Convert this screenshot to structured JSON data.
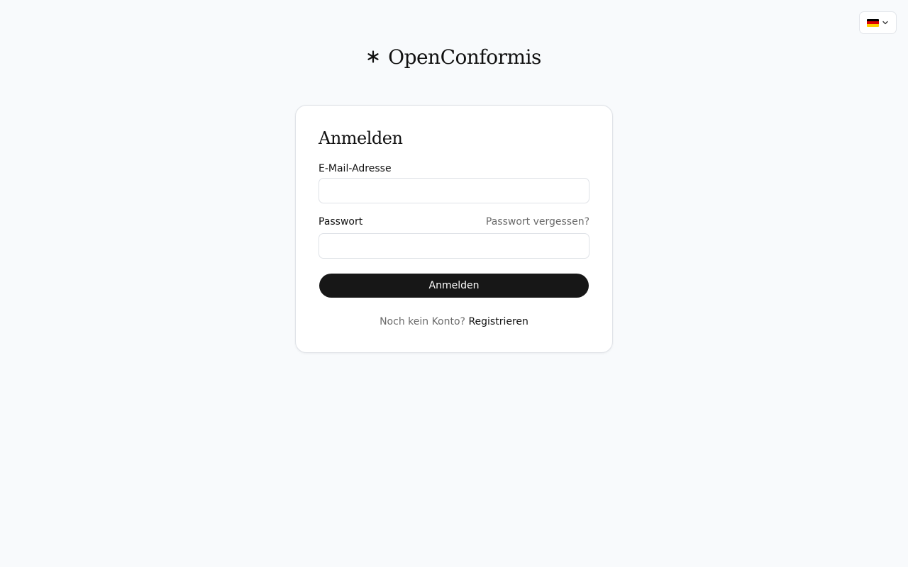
{
  "language": {
    "flag": "de",
    "flag_colors": [
      "#000000",
      "#dd0000",
      "#ffce00"
    ]
  },
  "brand": {
    "icon": "asterisk-icon",
    "name": "OpenConformis"
  },
  "login": {
    "title": "Anmelden",
    "email_label": "E-Mail-Adresse",
    "email_value": "",
    "password_label": "Passwort",
    "password_value": "",
    "forgot_password": "Passwort vergessen?",
    "submit_label": "Anmelden",
    "signup_prompt": "Noch kein Konto?",
    "signup_link": "Registrieren"
  },
  "colors": {
    "background": "#f8fafc",
    "button": "#171717",
    "muted_text": "#6b6b6b"
  }
}
